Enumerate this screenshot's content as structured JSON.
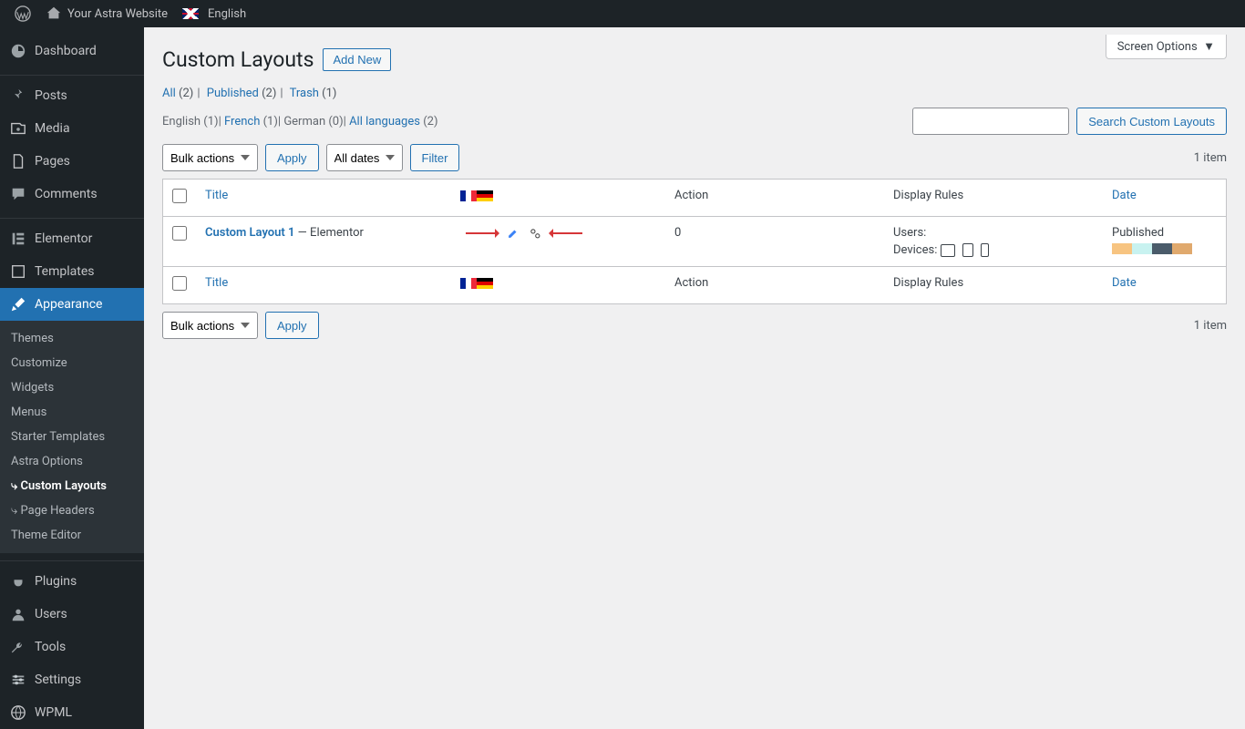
{
  "adminbar": {
    "site": "Your Astra Website",
    "lang": "English"
  },
  "screenOptions": "Screen Options",
  "sidebar": {
    "items": [
      {
        "label": "Dashboard",
        "icon": "dashboard"
      },
      {
        "label": "Posts",
        "icon": "pin"
      },
      {
        "label": "Media",
        "icon": "media"
      },
      {
        "label": "Pages",
        "icon": "page"
      },
      {
        "label": "Comments",
        "icon": "comment"
      },
      {
        "label": "Elementor",
        "icon": "elementor"
      },
      {
        "label": "Templates",
        "icon": "templates"
      },
      {
        "label": "Appearance",
        "icon": "brush",
        "current": true
      },
      {
        "label": "Plugins",
        "icon": "plug"
      },
      {
        "label": "Users",
        "icon": "user"
      },
      {
        "label": "Tools",
        "icon": "wrench"
      },
      {
        "label": "Settings",
        "icon": "settings"
      },
      {
        "label": "WPML",
        "icon": "globe"
      }
    ],
    "submenu": [
      {
        "label": "Themes"
      },
      {
        "label": "Customize"
      },
      {
        "label": "Widgets"
      },
      {
        "label": "Menus"
      },
      {
        "label": "Starter Templates"
      },
      {
        "label": "Astra Options"
      },
      {
        "label": "Custom Layouts",
        "current": true,
        "prefix": "⤷ "
      },
      {
        "label": "Page Headers",
        "prefix": "⤷ "
      },
      {
        "label": "Theme Editor"
      }
    ]
  },
  "page": {
    "title": "Custom Layouts",
    "addNew": "Add New",
    "views": {
      "all": "All",
      "allCount": "(2)",
      "pub": "Published",
      "pubCount": "(2)",
      "trash": "Trash",
      "trashCount": "(1)"
    },
    "langs": {
      "en": "English",
      "enCount": "(1)",
      "fr": "French",
      "frCount": "(1)",
      "de": "German",
      "deCount": "(0)",
      "all": "All languages",
      "allCount": "(2)"
    },
    "searchBtn": "Search Custom Layouts",
    "bulkActions": "Bulk actions",
    "apply": "Apply",
    "allDates": "All dates",
    "filter": "Filter",
    "itemCount": "1 item",
    "cols": {
      "title": "Title",
      "action": "Action",
      "display": "Display Rules",
      "date": "Date"
    },
    "row": {
      "title": "Custom Layout 1",
      "state": " — Elementor",
      "action": "0",
      "usersLabel": "Users:",
      "devicesLabel": "Devices:",
      "status": "Published",
      "swatches": [
        "#f7c481",
        "#c8f2f0",
        "#4a5b6a",
        "#e0a96d"
      ]
    }
  }
}
